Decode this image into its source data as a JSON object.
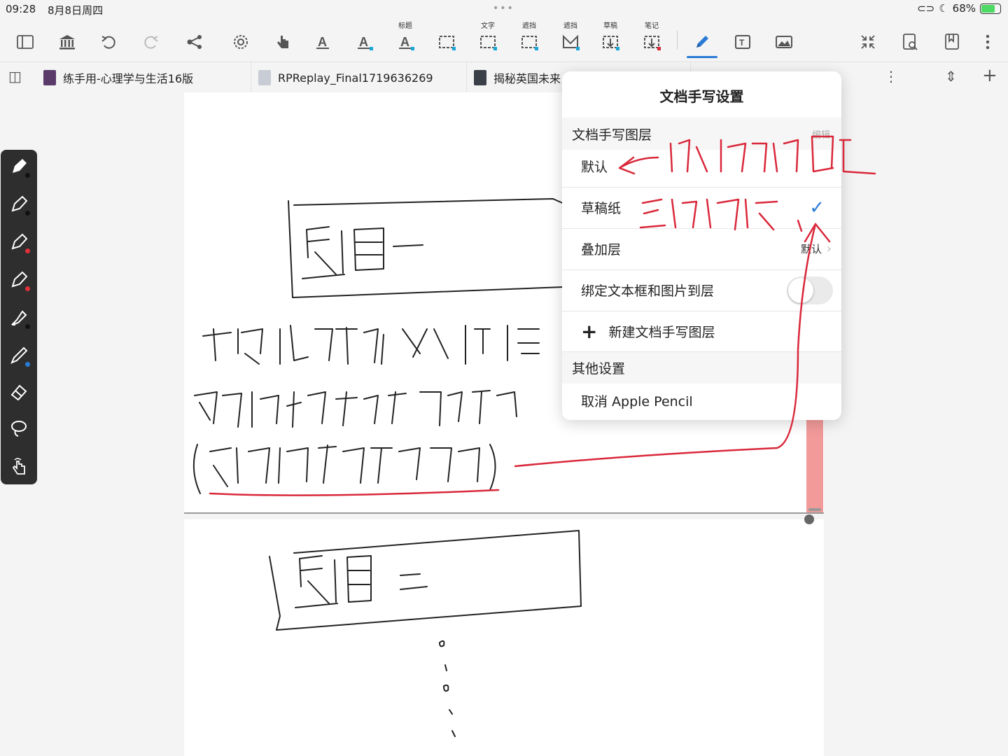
{
  "status_bar": {
    "time": "09:28",
    "date": "8月8日周四",
    "battery": "68%"
  },
  "toolbar": {
    "captions": {
      "title": "标题",
      "text": "文字",
      "mask1": "遮挡",
      "mask2": "遮挡",
      "draft": "草稿",
      "note": "笔记"
    }
  },
  "tabs": [
    {
      "label": "练手用-心理学与生活16版"
    },
    {
      "label": "RPReplay_Final1719636269"
    },
    {
      "label": "揭秘英国未来"
    }
  ],
  "popover": {
    "title": "文档手写设置",
    "layers_section": "文档手写图层",
    "edit_label": "编辑",
    "rows": {
      "default": "默认",
      "draft": "草稿纸",
      "overlay": "叠加层",
      "overlay_value": "默认",
      "bind": "绑定文本框和图片到层",
      "new_layer": "新建文档手写图层"
    },
    "bind_toggle": "off",
    "selected_layer": "草稿纸",
    "other_section": "其他设置",
    "cancel_pencil": "取消 Apple Pencil"
  },
  "colors": {
    "accent": "#2b7bd6",
    "annotation_red": "#d9283a",
    "scroll_thumb": "#f29a9a",
    "rail": "#2e2e2e"
  }
}
